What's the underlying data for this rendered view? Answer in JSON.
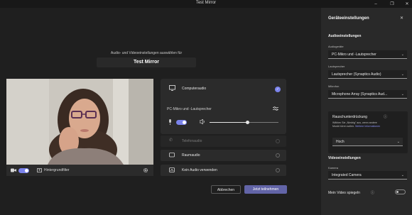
{
  "window": {
    "title": "Test Mirror",
    "minimize_glyph": "–",
    "maximize_glyph": "❐",
    "close_glyph": "✕"
  },
  "prejoin": {
    "heading": "Audio- und Videoeinstellungen auswählen für",
    "meeting_title": "Test Mirror"
  },
  "video_bar": {
    "camera_icon": "video-camera-icon",
    "bg_filter_label": "Hintergrundfilter",
    "settings_icon": "gear-icon",
    "camera_on": true
  },
  "audio": {
    "computer_audio_label": "Computeraudio",
    "device_label": "PC-Mikro und -Lautsprecher",
    "mic_on": true,
    "volume_level": 0.55,
    "phone_audio_label": "Telefonaudio",
    "room_audio_label": "Raumaudio",
    "no_audio_label": "Kein Audio verwenden",
    "selected": "computer_audio"
  },
  "buttons": {
    "cancel": "Abbrechen",
    "join": "Jetzt teilnehmen"
  },
  "settings": {
    "title": "Geräteeinstellungen",
    "close_glyph": "✕",
    "audio_section": "Audioeinstellungen",
    "audio_device_caption": "Audiogeräte",
    "audio_device_value": "PC-Mikro und -Lautsprecher",
    "speaker_caption": "Lautsprecher",
    "speaker_value": "Lautsprecher (Synaptics Audio)",
    "mic_caption": "Mikrofon",
    "mic_value": "Microphone Array (Synaptics Aud...",
    "noise": {
      "title": "Rauschunterdrückung",
      "info_glyph": "ⓘ",
      "desc_line1": "Wählen Sie „Niedrig\" aus, wenn andere",
      "desc_line2": "Musik hören sollen.",
      "link": "Weitere Informationen",
      "value": "Hoch"
    },
    "video_section": "Videoeinstellungen",
    "camera_caption": "Kamera",
    "camera_value": "Integrated Camera",
    "mirror_label": "Mein Video spiegeln",
    "mirror_info_glyph": "ⓘ",
    "mirror_on": false,
    "chevron": "⌄"
  },
  "colors": {
    "accent": "#7b83eb",
    "join_button": "#6264a7",
    "panel": "#292929",
    "background": "#1f1f1f"
  }
}
